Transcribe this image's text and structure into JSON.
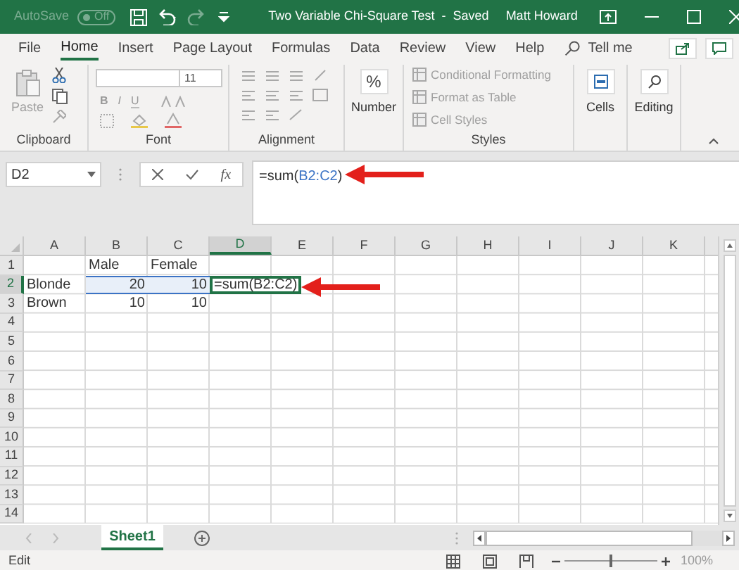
{
  "title_bar": {
    "autosave": "AutoSave",
    "autosave_toggle": {
      "label": "Off",
      "on": false
    },
    "title": "Two Variable Chi-Square Test  -  Saved",
    "user": "Matt Howard"
  },
  "ribbon_tabs": [
    {
      "label": "File",
      "selected": false
    },
    {
      "label": "Home",
      "selected": true
    },
    {
      "label": "Insert",
      "selected": false
    },
    {
      "label": "Page Layout",
      "selected": false
    },
    {
      "label": "Formulas",
      "selected": false
    },
    {
      "label": "Data",
      "selected": false
    },
    {
      "label": "Review",
      "selected": false
    },
    {
      "label": "View",
      "selected": false
    },
    {
      "label": "Help",
      "selected": false
    }
  ],
  "tell_me": "Tell me",
  "ribbon": {
    "clipboard": {
      "paste": "Paste",
      "label": "Clipboard"
    },
    "font": {
      "size": "11",
      "bold": "B",
      "italic": "I",
      "underline": "U",
      "label": "Font"
    },
    "alignment": {
      "label": "Alignment"
    },
    "number": {
      "symbol": "%",
      "label": "Number"
    },
    "styles": {
      "items": [
        "Conditional Formatting",
        "Format as Table",
        "Cell Styles"
      ],
      "label": "Styles"
    },
    "cells": {
      "label": "Cells"
    },
    "editing": {
      "label": "Editing"
    }
  },
  "name_box": "D2",
  "insert_function": "fx",
  "formula": {
    "prefix": "=sum(",
    "ref": "B2:C2",
    "suffix": ")"
  },
  "columns": [
    {
      "label": "A",
      "selected": false
    },
    {
      "label": "B",
      "selected": false
    },
    {
      "label": "C",
      "selected": false
    },
    {
      "label": "D",
      "selected": true
    },
    {
      "label": "E",
      "selected": false
    },
    {
      "label": "F",
      "selected": false
    },
    {
      "label": "G",
      "selected": false
    },
    {
      "label": "H",
      "selected": false
    },
    {
      "label": "I",
      "selected": false
    },
    {
      "label": "J",
      "selected": false
    },
    {
      "label": "K",
      "selected": false
    }
  ],
  "rows": [
    {
      "label": "1",
      "selected": false,
      "cells": {
        "B": {
          "kind": "text",
          "text": "Male",
          "referenced": false
        },
        "C": {
          "kind": "text",
          "text": "Female",
          "referenced": false
        }
      }
    },
    {
      "label": "2",
      "selected": true,
      "cells": {
        "A": {
          "kind": "text",
          "text": "Blonde",
          "referenced": false
        },
        "B": {
          "kind": "number",
          "text": "20",
          "referenced": true
        },
        "C": {
          "kind": "number",
          "text": "10",
          "referenced": true
        },
        "D": {
          "kind": "formula",
          "prefix": "=sum(",
          "ref": "B2:C2",
          "suffix": ")",
          "referenced": false
        }
      }
    },
    {
      "label": "3",
      "selected": false,
      "cells": {
        "A": {
          "kind": "text",
          "text": "Brown",
          "referenced": false
        },
        "B": {
          "kind": "number",
          "text": "10",
          "referenced": false
        },
        "C": {
          "kind": "number",
          "text": "10",
          "referenced": false
        }
      }
    },
    {
      "label": "4",
      "selected": false
    },
    {
      "label": "5",
      "selected": false
    },
    {
      "label": "6",
      "selected": false
    },
    {
      "label": "7",
      "selected": false
    },
    {
      "label": "8",
      "selected": false
    },
    {
      "label": "9",
      "selected": false
    },
    {
      "label": "10",
      "selected": false
    },
    {
      "label": "11",
      "selected": false
    },
    {
      "label": "12",
      "selected": false
    },
    {
      "label": "13",
      "selected": false
    },
    {
      "label": "14",
      "selected": false
    }
  ],
  "sheet_tabs": [
    {
      "label": "Sheet1",
      "selected": true
    }
  ],
  "status_bar": {
    "mode": "Edit",
    "zoom": "100%",
    "zoom_slider": {
      "level": 0.5
    }
  }
}
